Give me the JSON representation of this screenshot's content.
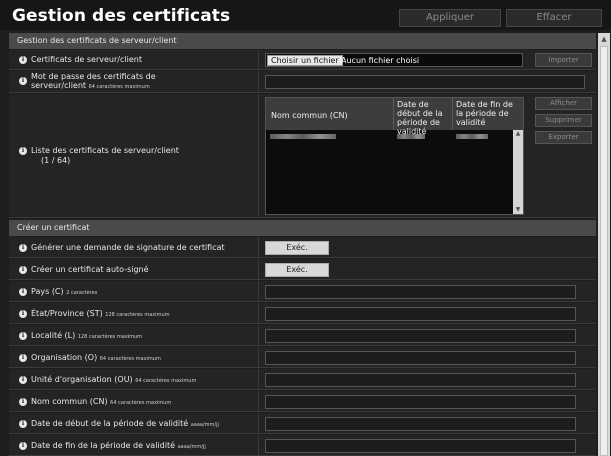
{
  "header": {
    "title": "Gestion des certificats",
    "apply_label": "Appliquer",
    "clear_label": "Effacer"
  },
  "server_client": {
    "section_title": "Gestion des certificats de serveur/client",
    "certs_label": "Certificats de serveur/client",
    "file_button_label": "Choisir un fichier",
    "file_status": "Aucun fichier choisi",
    "import_label": "Importer",
    "password_label_line1": "Mot de passe des certificats de",
    "password_label_line2": "serveur/client",
    "password_hint": "64 caractères maximum",
    "list_label": "Liste des certificats de serveur/client",
    "list_count": "(1 / 64)",
    "table_headers": {
      "cn": "Nom commun (CN)",
      "start": "Date de début de la période de validité",
      "end": "Date de fin de la période de validité"
    },
    "show_label": "Afficher",
    "delete_label": "Supprimer",
    "export_label": "Exporter"
  },
  "create": {
    "section_title": "Créer un certificat",
    "csr_label": "Générer une demande de signature de certificat",
    "selfsigned_label": "Créer un certificat auto-signé",
    "exec_label": "Exéc.",
    "fields": [
      {
        "label": "Pays (C)",
        "hint": "2 caractères"
      },
      {
        "label": "État/Province (ST)",
        "hint": "128 caractères maximum"
      },
      {
        "label": "Localité (L)",
        "hint": "128 caractères maximum"
      },
      {
        "label": "Organisation (O)",
        "hint": "64 caractères maximum"
      },
      {
        "label": "Unité d'organisation (OU)",
        "hint": "64 caractères maximum"
      },
      {
        "label": "Nom commun (CN)",
        "hint": "64 caractères maximum"
      },
      {
        "label": "Date de début de la période de validité",
        "hint": "aaaa/mm/jj"
      },
      {
        "label": "Date de fin de la période de validité",
        "hint": "aaaa/mm/jj"
      }
    ]
  },
  "icons": {
    "info": "info-icon",
    "scroll_up": "scroll-up-arrow-icon",
    "scroll_down": "scroll-down-arrow-icon"
  },
  "colors": {
    "background": "#1e1e1e",
    "section_header": "#4a4a4a",
    "row": "#242424"
  }
}
